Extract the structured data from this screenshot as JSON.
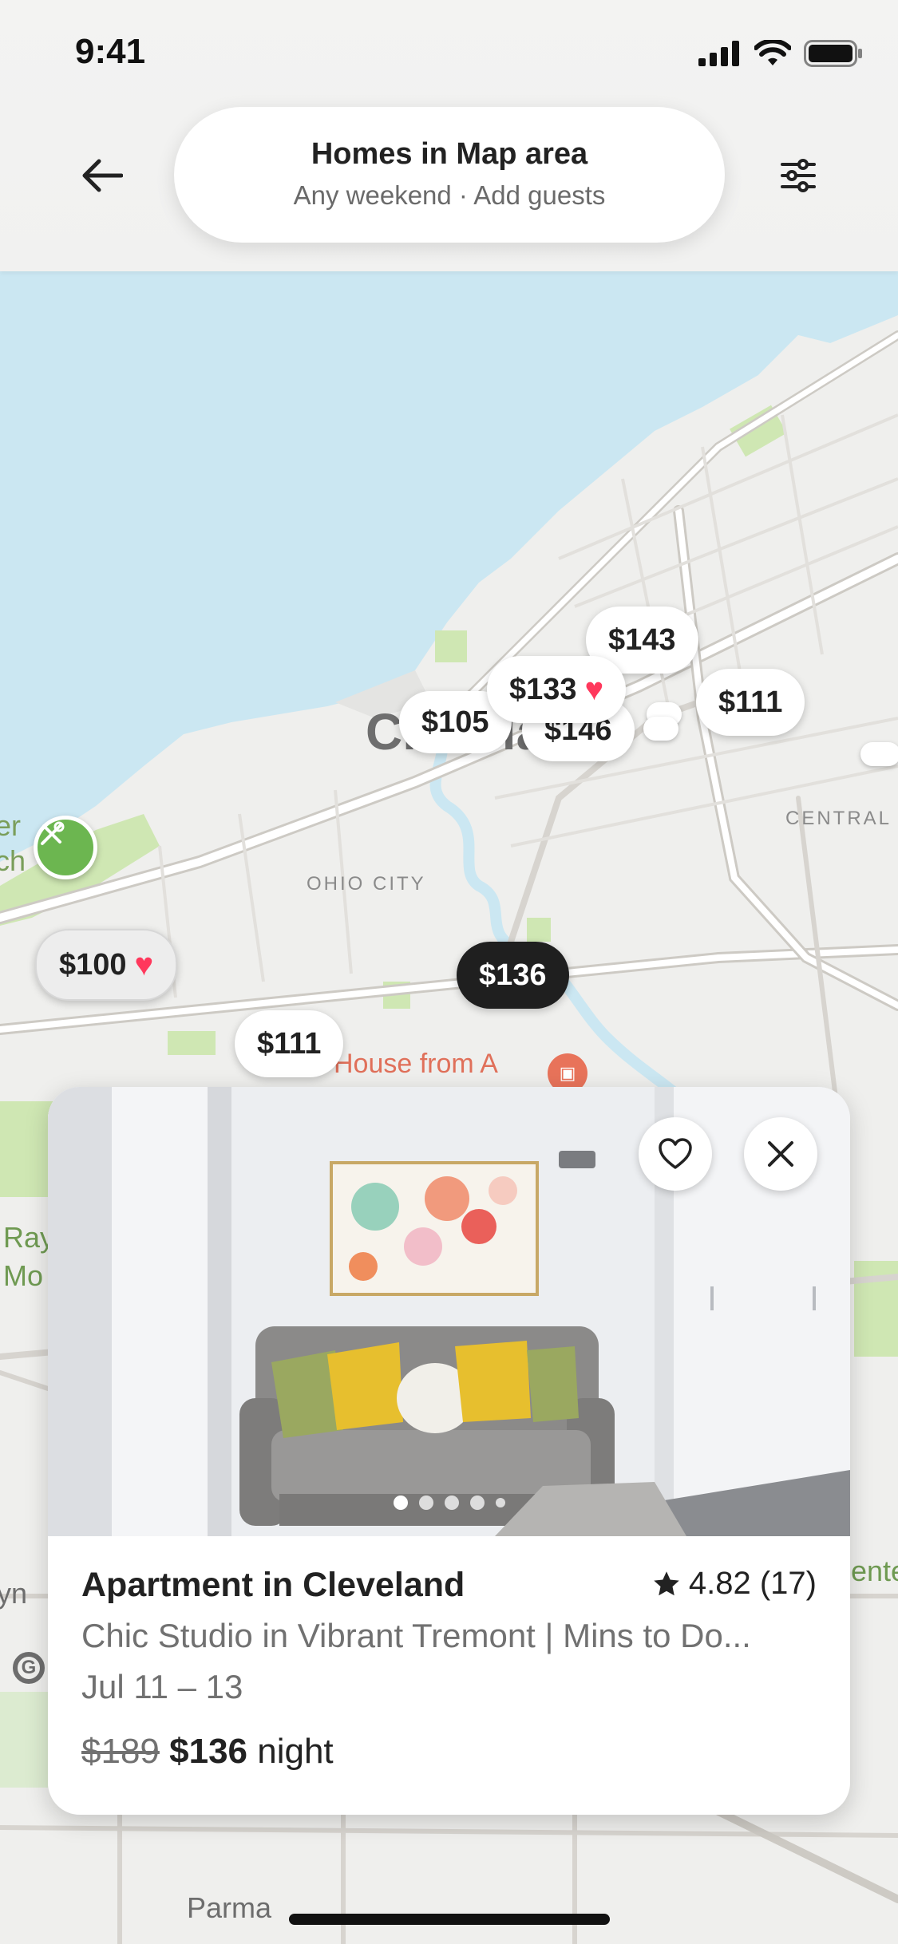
{
  "status_bar": {
    "time": "9:41"
  },
  "header": {
    "title": "Homes in Map area",
    "subtitle": "Any weekend · Add guests"
  },
  "map": {
    "city": "Cleveland",
    "neighborhood_labels": [
      "OHIO CITY",
      "CENTRAL"
    ],
    "poi_label": "House from A",
    "side_labels": [
      "er",
      "ch",
      "Ray",
      "Mo",
      "yn",
      "ente"
    ],
    "bottom_label": "Parma",
    "colors": {
      "water": "#cbe7f2",
      "land": "#efefed",
      "park": "#cfe7b3",
      "road": "#ffffff",
      "road_edge": "#cdcac4"
    }
  },
  "pins": [
    {
      "label": "$143",
      "favorite": false,
      "selected": false
    },
    {
      "label": "$133",
      "favorite": true,
      "selected": false
    },
    {
      "label": "$105",
      "favorite": false,
      "selected": false
    },
    {
      "label": "$146",
      "favorite": false,
      "selected": false
    },
    {
      "label": "$111",
      "favorite": false,
      "selected": false
    },
    {
      "label": "$100",
      "favorite": true,
      "selected": false
    },
    {
      "label": "$136",
      "favorite": false,
      "selected": true
    },
    {
      "label": "$111",
      "favorite": false,
      "selected": false
    }
  ],
  "listing": {
    "title": "Apartment in Cleveland",
    "rating": "4.82 (17)",
    "subtitle": "Chic Studio in Vibrant Tremont | Mins to Do...",
    "dates": "Jul 11 – 13",
    "original_price": "$189",
    "price": "$136",
    "price_unit": " night",
    "photo_count": 5,
    "active_photo": 1
  },
  "icons": {
    "back": "arrow-left-icon",
    "filter": "sliders-icon",
    "favorite": "heart-outline-icon",
    "close": "close-icon",
    "star": "star-icon",
    "favorite_pin": "heart-filled-icon"
  },
  "colors": {
    "accent": "#ff385c",
    "dark_pin": "#1f1f1f",
    "text": "#222222",
    "muted": "#717171"
  }
}
